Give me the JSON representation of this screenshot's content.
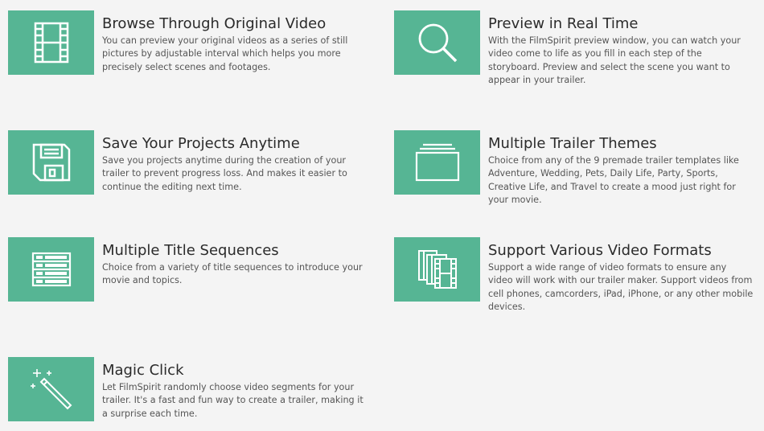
{
  "colors": {
    "accent": "#56b594",
    "background": "#f4f4f4",
    "title": "#2b2b2b",
    "text": "#555555"
  },
  "features": [
    {
      "icon": "film-strip-icon",
      "title": "Browse Through Original Video",
      "description": "You can preview your original videos as a series of still pictures by adjustable interval which helps you more precisely select scenes and footages."
    },
    {
      "icon": "magnifier-icon",
      "title": "Preview in Real Time",
      "description": "With the FilmSpirit preview window, you can watch your video come to life as you fill in each step of the storyboard. Preview and select the scene you want to appear in your trailer."
    },
    {
      "icon": "floppy-disk-icon",
      "title": "Save Your Projects Anytime",
      "description": "Save you projects anytime during the creation of your trailer to prevent progress loss. And makes it easier to continue the editing next time."
    },
    {
      "icon": "stacked-frames-icon",
      "title": "Multiple Trailer Themes",
      "description": "Choice from any of the 9 premade trailer templates like Adventure, Wedding, Pets, Daily Life, Party, Sports, Creative Life, and Travel to create a mood just right for your movie."
    },
    {
      "icon": "title-list-icon",
      "title": "Multiple Title Sequences",
      "description": "Choice from a variety of title sequences to introduce your movie and topics."
    },
    {
      "icon": "multiple-films-icon",
      "title": "Support Various Video Formats",
      "description": "Support a wide range of video formats to ensure any video will work with our trailer maker. Support videos from cell phones, camcorders, iPad, iPhone, or any other mobile devices."
    },
    {
      "icon": "magic-wand-icon",
      "title": "Magic Click",
      "description": "Let FilmSpirit randomly choose video segments for your trailer. It's a fast and fun way to create a trailer, making it a surprise each time."
    }
  ]
}
